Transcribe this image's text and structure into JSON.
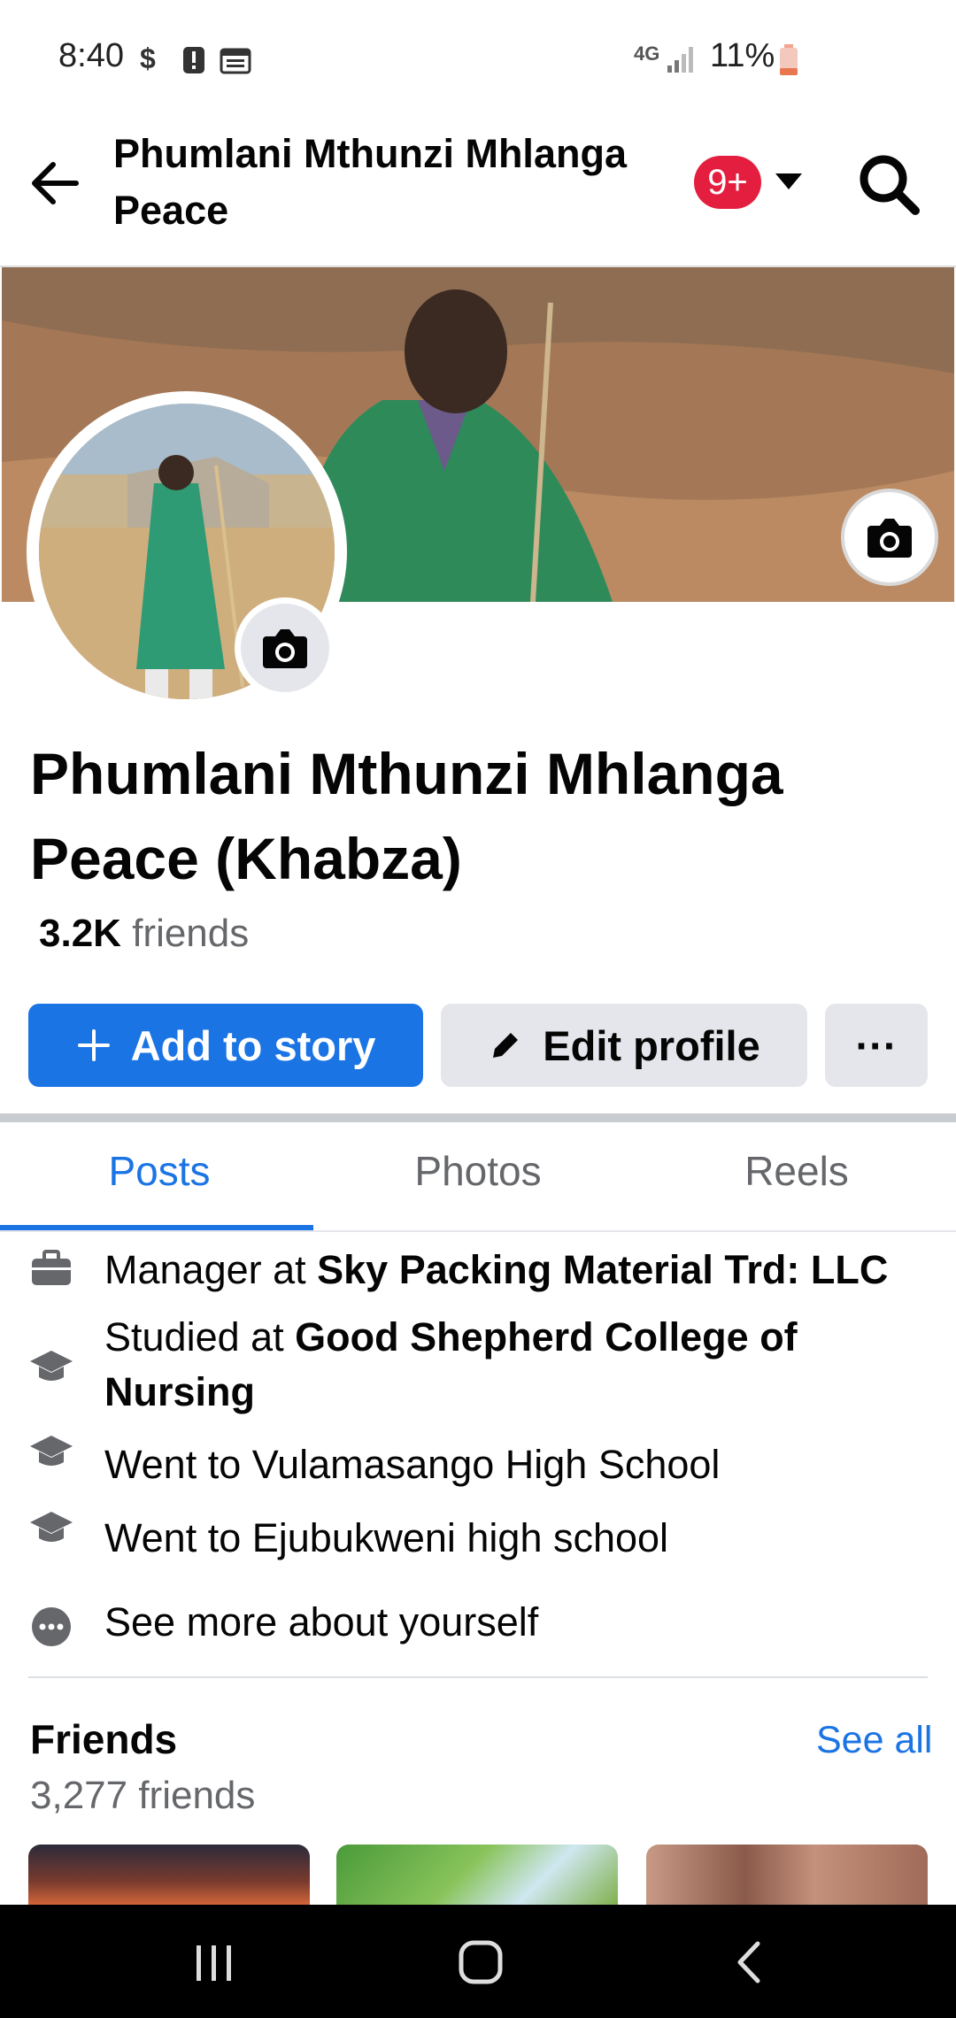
{
  "status_bar": {
    "time": "8:40",
    "network": "4G",
    "battery": "11%"
  },
  "header": {
    "title": "Phumlani Mthunzi Mhlanga Peace",
    "badge": "9+"
  },
  "profile": {
    "name": "Phumlani Mthunzi Mhlanga Peace (Khabza)",
    "friends_count": "3.2K",
    "friends_word": "friends"
  },
  "actions": {
    "add_story": "Add to story",
    "edit_profile": "Edit profile",
    "more": "···"
  },
  "tabs": [
    {
      "label": "Posts",
      "active": true
    },
    {
      "label": "Photos",
      "active": false
    },
    {
      "label": "Reels",
      "active": false
    }
  ],
  "intro": [
    {
      "icon": "briefcase-icon",
      "prefix": "Manager at ",
      "bold": "Sky Packing Material Trd: LLC"
    },
    {
      "icon": "graduation-cap-icon",
      "prefix": "Studied at ",
      "bold": "Good Shepherd College of Nursing"
    },
    {
      "icon": "graduation-cap-icon",
      "prefix": "Went to Vulamasango High School",
      "bold": ""
    },
    {
      "icon": "graduation-cap-icon",
      "prefix": "Went to Ejubukweni high school",
      "bold": ""
    },
    {
      "icon": "more-dots-icon",
      "prefix": "See more about yourself",
      "bold": ""
    }
  ],
  "friends_section": {
    "title": "Friends",
    "see_all": "See all",
    "count_text": "3,277 friends"
  },
  "colors": {
    "accent": "#1b74e4",
    "badge": "#e41e3f",
    "secondary_text": "#65676b"
  }
}
